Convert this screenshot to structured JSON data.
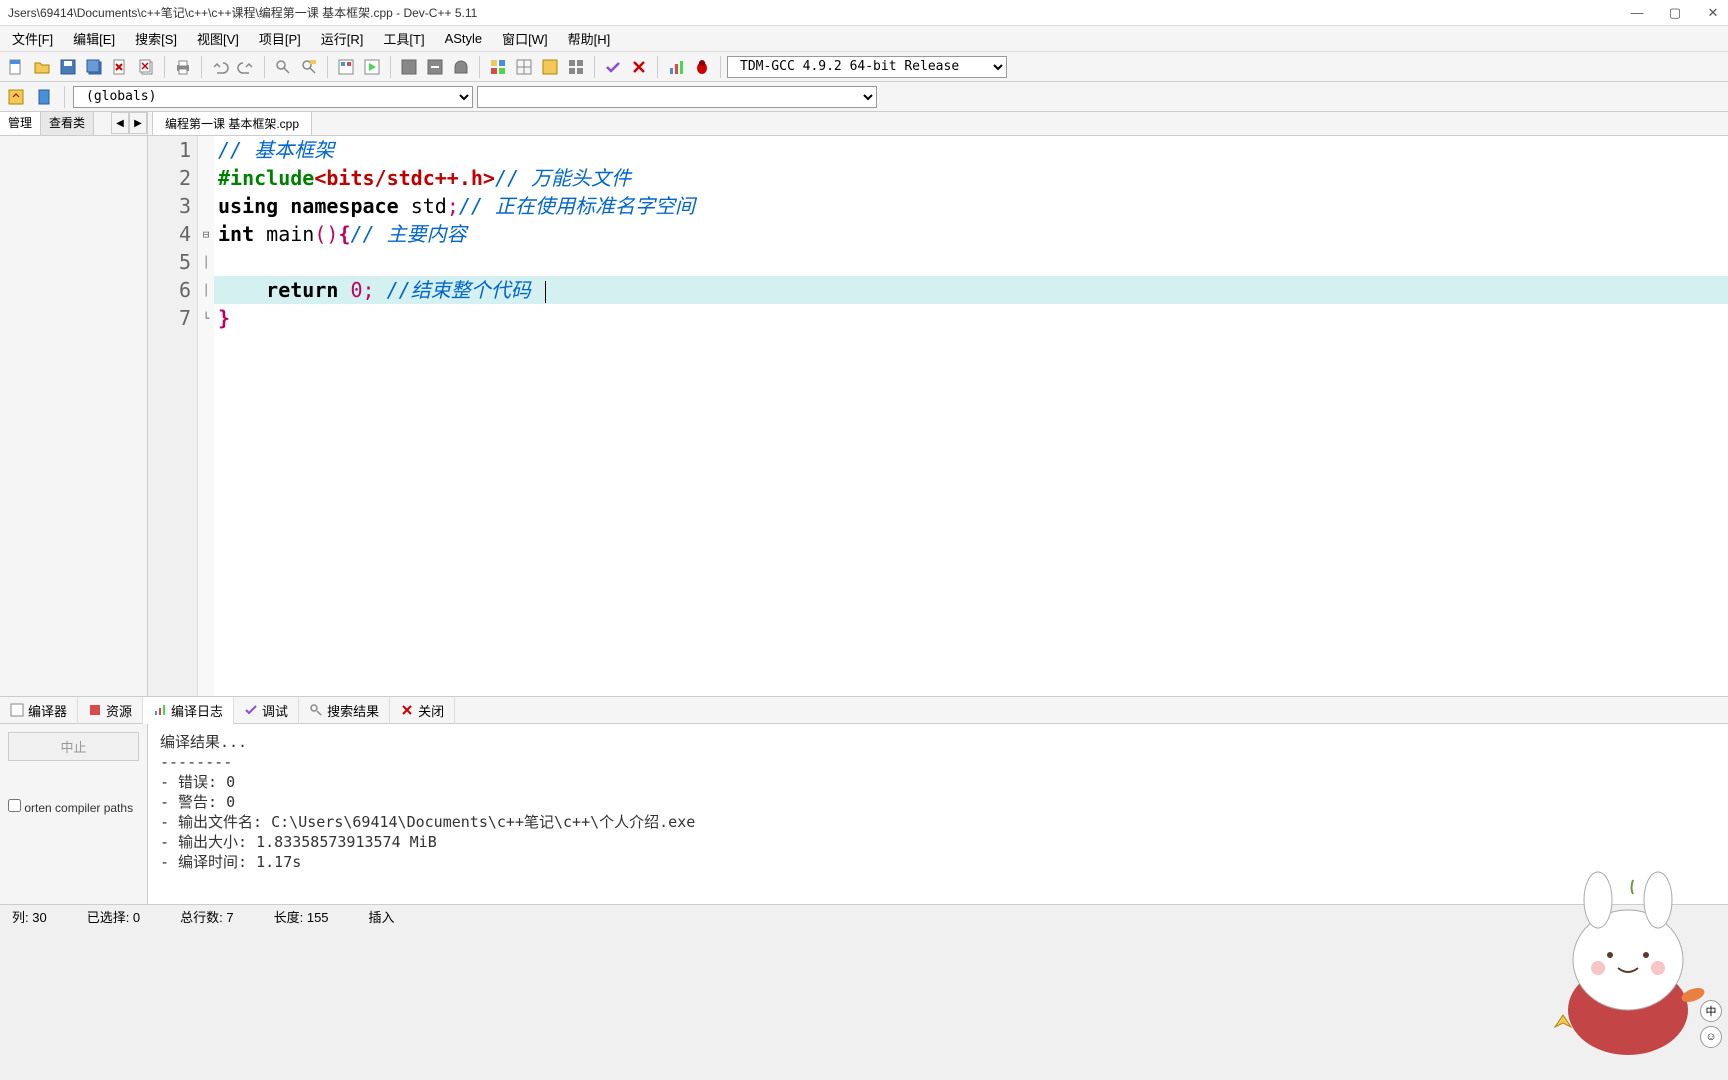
{
  "title": "Jsers\\69414\\Documents\\c++笔记\\c++\\c++课程\\编程第一课 基本框架.cpp - Dev-C++ 5.11",
  "menu": [
    "文件[F]",
    "编辑[E]",
    "搜索[S]",
    "视图[V]",
    "项目[P]",
    "运行[R]",
    "工具[T]",
    "AStyle",
    "窗口[W]",
    "帮助[H]"
  ],
  "compiler_select": "TDM-GCC 4.9.2 64-bit Release",
  "scope_select": "(globals)",
  "sidebar_tabs": {
    "a": "管理",
    "b": "查看类"
  },
  "file_tab": "编程第一课 基本框架.cpp",
  "code": {
    "l1_comment": "// 基本框架",
    "l2_prep": "#include",
    "l2_inc": "<bits/stdc++.h>",
    "l2_comment": "// 万能头文件",
    "l3_kw1": "using",
    "l3_kw2": "namespace",
    "l3_id": "std",
    "l3_comment": "// 正在使用标准名字空间",
    "l4_kw1": "int",
    "l4_kw2": "main",
    "l4_comment": "// 主要内容",
    "l6_kw": "return",
    "l6_num": "0",
    "l6_comment": "//结束整个代码 "
  },
  "bottom_tabs": {
    "a": "编译器",
    "b": "资源",
    "c": "编译日志",
    "d": "调试",
    "e": "搜索结果",
    "f": "关闭"
  },
  "bp_abort": "中止",
  "bp_shorten": "orten compiler paths",
  "compile_result": {
    "title": "编译结果...",
    "sep": "--------",
    "err": "- 错误: 0",
    "warn": "- 警告: 0",
    "out": "- 输出文件名: C:\\Users\\69414\\Documents\\c++笔记\\c++\\个人介绍.exe",
    "size": "- 输出大小: 1.83358573913574 MiB",
    "time": "- 编译时间: 1.17s"
  },
  "status": {
    "col": "列:  30",
    "sel": "已选择:  0",
    "lines": "总行数:  7",
    "len": "长度:  155",
    "ins": "插入"
  },
  "ime": "中"
}
